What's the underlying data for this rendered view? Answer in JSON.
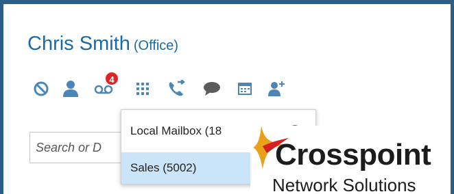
{
  "contact": {
    "name": "Chris Smith",
    "status": "(Office)"
  },
  "toolbar": {
    "icons": [
      "do-not-disturb-icon",
      "person-icon",
      "voicemail-icon",
      "dialpad-icon",
      "call-forward-icon",
      "chat-icon",
      "calendar-icon",
      "add-contact-icon"
    ],
    "voicemail_badge": "4"
  },
  "search": {
    "placeholder": "Search or D"
  },
  "mailbox_menu": {
    "items": [
      {
        "label": "Local Mailbox (18",
        "selected": false
      },
      {
        "label": "Sales (5002)",
        "selected": true
      }
    ]
  },
  "logo": {
    "name": "Crosspoint",
    "tagline": "Network Solutions"
  },
  "colors": {
    "accent": "#1a6aa8",
    "icon": "#4a86b8",
    "icon_gray": "#5c5c5c",
    "badge": "#e32222",
    "selected_row": "#cce4f7",
    "frame_border": "#2c5f88"
  }
}
